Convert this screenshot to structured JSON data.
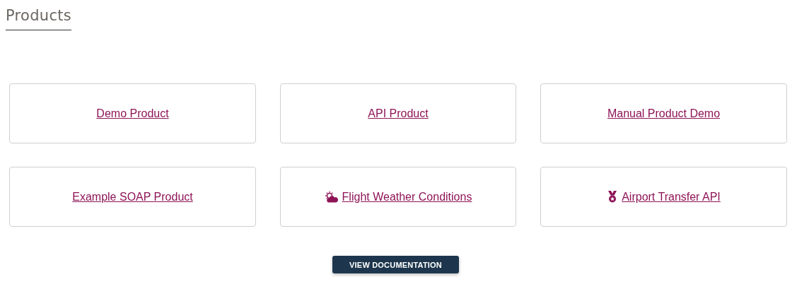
{
  "title": "Products",
  "products": [
    {
      "name": "Demo Product",
      "kind": "plain"
    },
    {
      "name": "API Product",
      "kind": "plain"
    },
    {
      "name": "Manual Product Demo",
      "kind": "plain"
    },
    {
      "name": "Example SOAP Product",
      "kind": "plain"
    },
    {
      "name": "Flight Weather Conditions",
      "kind": "weather"
    },
    {
      "name": "Airport Transfer API",
      "kind": "medal"
    }
  ],
  "button": "VIEW DOCUMENTATION"
}
